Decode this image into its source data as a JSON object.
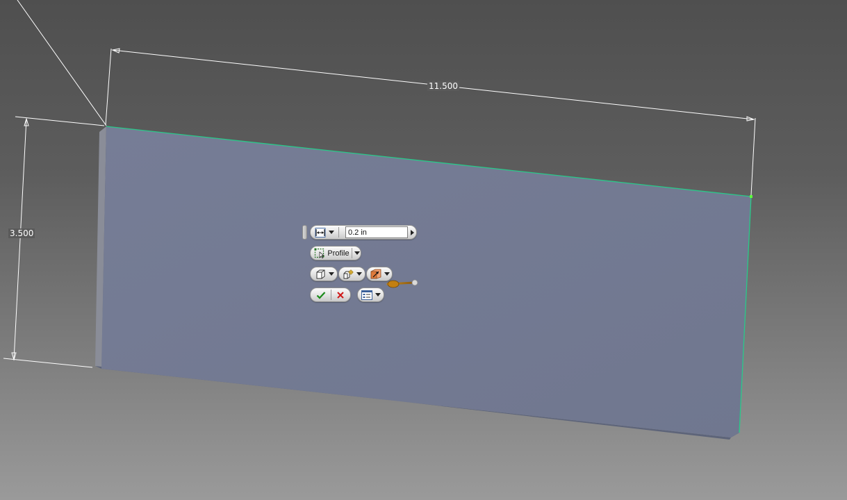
{
  "dimensions": {
    "width_value": "11.500",
    "height_value": "3.500"
  },
  "minitoolbar": {
    "distance_value": "0.2 in",
    "profile_label": "Profile",
    "icons": {
      "extents": "distance-extents-icon",
      "profile": "profile-select-icon",
      "output": "solid-output-icon",
      "operation": "join-operation-icon",
      "direction": "direction-icon",
      "ok": "checkmark-icon",
      "cancel": "close-icon",
      "dialog": "dialog-options-icon",
      "manipulator": "distance-manipulator-icon",
      "expand": "expand-arrow-icon"
    }
  },
  "colors": {
    "part_face": "#737a93",
    "selected_edge": "#29c98a",
    "ok_green": "#1a8a1a",
    "cancel_red": "#d01818"
  }
}
